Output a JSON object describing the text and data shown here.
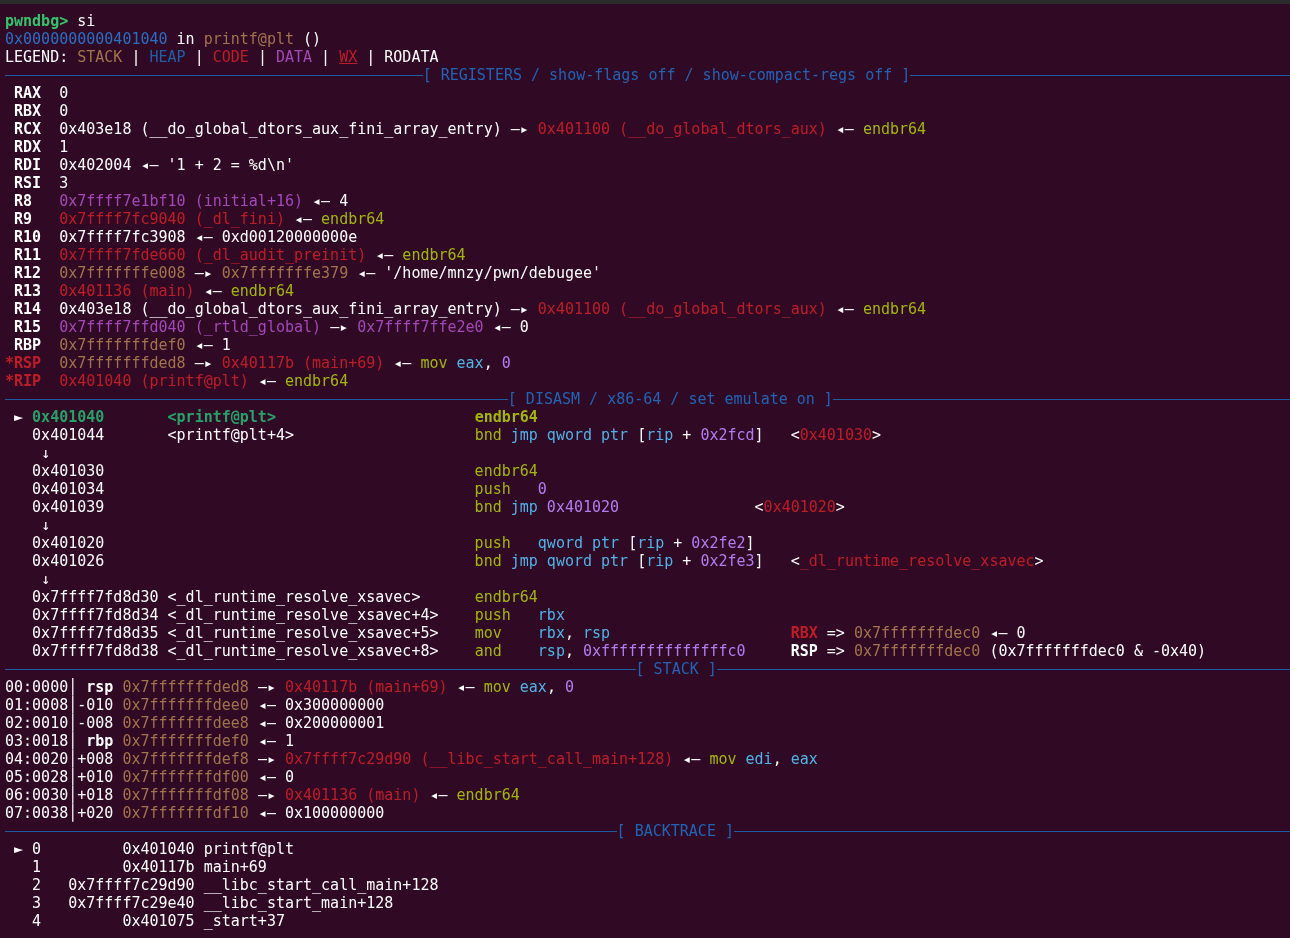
{
  "top_lines": [
    [
      {
        "text": "pwndbg>",
        "kind": "prompt"
      },
      {
        "text": " si",
        "kind": "plain"
      }
    ],
    [
      {
        "text": "0x0000000000401040",
        "kind": "addr"
      },
      {
        "text": " in",
        "kind": "plain"
      },
      {
        "text": " printf@plt",
        "kind": "stack"
      },
      {
        "text": " ()",
        "kind": "plain"
      }
    ],
    [
      {
        "text": "LEGEND:",
        "kind": "plain"
      },
      {
        "text": " STACK",
        "kind": "stack"
      },
      {
        "text": " |",
        "kind": "plain"
      },
      {
        "text": " HEAP",
        "kind": "heap"
      },
      {
        "text": " |",
        "kind": "plain"
      },
      {
        "text": " CODE",
        "kind": "code"
      },
      {
        "text": " |",
        "kind": "plain"
      },
      {
        "text": " DATA",
        "kind": "data"
      },
      {
        "text": " |",
        "kind": "plain"
      },
      {
        "text": " WX",
        "kind": "wx"
      },
      {
        "text": " |",
        "kind": "plain"
      },
      {
        "text": " RODATA",
        "kind": "plain"
      }
    ]
  ],
  "sections": [
    {
      "title": "[ REGISTERS / show-flags off / show-compact-regs off ]",
      "lines": [
        [
          {
            "text": " RAX",
            "kind": "bold"
          },
          {
            "text": "  0",
            "kind": "plain"
          }
        ],
        [
          {
            "text": " RBX",
            "kind": "bold"
          },
          {
            "text": "  0",
            "kind": "plain"
          }
        ],
        [
          {
            "text": " RCX",
            "kind": "bold"
          },
          {
            "text": "  0x403e18 (__do_global_dtors_aux_fini_array_entry)",
            "kind": "plain"
          },
          {
            "text": " —▸",
            "kind": "plain"
          },
          {
            "text": " 0x401100 (__do_global_dtors_aux)",
            "kind": "code"
          },
          {
            "text": " ◂—",
            "kind": "plain"
          },
          {
            "text": " endbr64",
            "kind": "insn"
          }
        ],
        [
          {
            "text": " RDX",
            "kind": "bold"
          },
          {
            "text": "  1",
            "kind": "plain"
          }
        ],
        [
          {
            "text": " RDI",
            "kind": "bold"
          },
          {
            "text": "  0x402004",
            "kind": "plain"
          },
          {
            "text": " ◂—",
            "kind": "plain"
          },
          {
            "text": " '1 + 2 = %d\\n'",
            "kind": "plain"
          }
        ],
        [
          {
            "text": " RSI",
            "kind": "bold"
          },
          {
            "text": "  3",
            "kind": "plain"
          }
        ],
        [
          {
            "text": " R8",
            "kind": "bold"
          },
          {
            "text": "   0x7ffff7e1bf10 (initial+16)",
            "kind": "data"
          },
          {
            "text": " ◂—",
            "kind": "plain"
          },
          {
            "text": " 4",
            "kind": "plain"
          }
        ],
        [
          {
            "text": " R9",
            "kind": "bold"
          },
          {
            "text": "   0x7ffff7fc9040 (_dl_fini)",
            "kind": "code"
          },
          {
            "text": " ◂—",
            "kind": "plain"
          },
          {
            "text": " endbr64",
            "kind": "insn"
          }
        ],
        [
          {
            "text": " R10",
            "kind": "bold"
          },
          {
            "text": "  0x7ffff7fc3908",
            "kind": "plain"
          },
          {
            "text": " ◂—",
            "kind": "plain"
          },
          {
            "text": " 0xd00120000000e",
            "kind": "plain"
          }
        ],
        [
          {
            "text": " R11",
            "kind": "bold"
          },
          {
            "text": "  0x7ffff7fde660 (_dl_audit_preinit)",
            "kind": "code"
          },
          {
            "text": " ◂—",
            "kind": "plain"
          },
          {
            "text": " endbr64",
            "kind": "insn"
          }
        ],
        [
          {
            "text": " R12",
            "kind": "bold"
          },
          {
            "text": "  0x7fffffffe008",
            "kind": "stack"
          },
          {
            "text": " —▸",
            "kind": "plain"
          },
          {
            "text": " 0x7fffffffe379",
            "kind": "stack"
          },
          {
            "text": " ◂—",
            "kind": "plain"
          },
          {
            "text": " '/home/mnzy/pwn/debugee'",
            "kind": "plain"
          }
        ],
        [
          {
            "text": " R13",
            "kind": "bold"
          },
          {
            "text": "  0x401136 (main)",
            "kind": "code"
          },
          {
            "text": " ◂—",
            "kind": "plain"
          },
          {
            "text": " endbr64",
            "kind": "insn"
          }
        ],
        [
          {
            "text": " R14",
            "kind": "bold"
          },
          {
            "text": "  0x403e18 (__do_global_dtors_aux_fini_array_entry)",
            "kind": "plain"
          },
          {
            "text": " —▸",
            "kind": "plain"
          },
          {
            "text": " 0x401100 (__do_global_dtors_aux)",
            "kind": "code"
          },
          {
            "text": " ◂—",
            "kind": "plain"
          },
          {
            "text": " endbr64",
            "kind": "insn"
          }
        ],
        [
          {
            "text": " R15",
            "kind": "bold"
          },
          {
            "text": "  0x7ffff7ffd040 (_rtld_global)",
            "kind": "data"
          },
          {
            "text": " —▸",
            "kind": "plain"
          },
          {
            "text": " 0x7ffff7ffe2e0",
            "kind": "data"
          },
          {
            "text": " ◂—",
            "kind": "plain"
          },
          {
            "text": " 0",
            "kind": "plain"
          }
        ],
        [
          {
            "text": " RBP",
            "kind": "bold"
          },
          {
            "text": "  0x7fffffffdef0",
            "kind": "stack"
          },
          {
            "text": " ◂—",
            "kind": "plain"
          },
          {
            "text": " 1",
            "kind": "plain"
          }
        ],
        [
          {
            "text": "*RSP",
            "kind": "boldred"
          },
          {
            "text": "  0x7fffffffded8",
            "kind": "stack"
          },
          {
            "text": " —▸",
            "kind": "plain"
          },
          {
            "text": " 0x40117b (main+69)",
            "kind": "code"
          },
          {
            "text": " ◂—",
            "kind": "plain"
          },
          {
            "text": " mov",
            "kind": "insn"
          },
          {
            "text": " eax",
            "kind": "reg"
          },
          {
            "text": ",",
            "kind": "plain"
          },
          {
            "text": " 0",
            "kind": "imm"
          }
        ],
        [
          {
            "text": "*RIP",
            "kind": "boldred"
          },
          {
            "text": "  0x401040 (printf@plt)",
            "kind": "code"
          },
          {
            "text": " ◂—",
            "kind": "plain"
          },
          {
            "text": " endbr64",
            "kind": "insn"
          }
        ]
      ]
    },
    {
      "title": "[ DISASM / x86-64 / set emulate on ]",
      "lines": [
        [
          {
            "text": " ►",
            "kind": "plain"
          },
          {
            "text": " 0x401040",
            "kind": "cur"
          },
          {
            "text": "       <printf@plt>",
            "kind": "cur"
          },
          {
            "text": "                      endbr64",
            "kind": "insnbold"
          }
        ],
        [
          {
            "text": "   0x401044",
            "kind": "plain"
          },
          {
            "text": "       <printf@plt+4>",
            "kind": "plain"
          },
          {
            "text": "                    bnd",
            "kind": "insn"
          },
          {
            "text": " jmp qword ptr",
            "kind": "reg"
          },
          {
            "text": " [",
            "kind": "plain"
          },
          {
            "text": "rip",
            "kind": "reg"
          },
          {
            "text": " +",
            "kind": "plain"
          },
          {
            "text": " 0x2fcd",
            "kind": "imm"
          },
          {
            "text": "]",
            "kind": "plain"
          },
          {
            "text": "   <",
            "kind": "plain"
          },
          {
            "text": "0x401030",
            "kind": "code"
          },
          {
            "text": ">",
            "kind": "plain"
          }
        ],
        [
          {
            "text": "    ↓",
            "kind": "plain"
          }
        ],
        [
          {
            "text": "   0x401030",
            "kind": "plain"
          },
          {
            "text": "                                         endbr64",
            "kind": "insn"
          }
        ],
        [
          {
            "text": "   0x401034",
            "kind": "plain"
          },
          {
            "text": "                                         push",
            "kind": "insn"
          },
          {
            "text": "   0",
            "kind": "imm"
          }
        ],
        [
          {
            "text": "   0x401039",
            "kind": "plain"
          },
          {
            "text": "                                         bnd",
            "kind": "insn"
          },
          {
            "text": " jmp",
            "kind": "reg"
          },
          {
            "text": " 0x401020",
            "kind": "imm"
          },
          {
            "text": "               <",
            "kind": "plain"
          },
          {
            "text": "0x401020",
            "kind": "code"
          },
          {
            "text": ">",
            "kind": "plain"
          }
        ],
        [
          {
            "text": "    ↓",
            "kind": "plain"
          }
        ],
        [
          {
            "text": "   0x401020",
            "kind": "plain"
          },
          {
            "text": "                                         push",
            "kind": "insn"
          },
          {
            "text": "   qword ptr",
            "kind": "reg"
          },
          {
            "text": " [",
            "kind": "plain"
          },
          {
            "text": "rip",
            "kind": "reg"
          },
          {
            "text": " +",
            "kind": "plain"
          },
          {
            "text": " 0x2fe2",
            "kind": "imm"
          },
          {
            "text": "]",
            "kind": "plain"
          }
        ],
        [
          {
            "text": "   0x401026",
            "kind": "plain"
          },
          {
            "text": "                                         bnd",
            "kind": "insn"
          },
          {
            "text": " jmp qword ptr",
            "kind": "reg"
          },
          {
            "text": " [",
            "kind": "plain"
          },
          {
            "text": "rip",
            "kind": "reg"
          },
          {
            "text": " +",
            "kind": "plain"
          },
          {
            "text": " 0x2fe3",
            "kind": "imm"
          },
          {
            "text": "]",
            "kind": "plain"
          },
          {
            "text": "   <",
            "kind": "plain"
          },
          {
            "text": "_dl_runtime_resolve_xsavec",
            "kind": "code"
          },
          {
            "text": ">",
            "kind": "plain"
          }
        ],
        [
          {
            "text": "    ↓",
            "kind": "plain"
          }
        ],
        [
          {
            "text": "   0x7ffff7fd8d30",
            "kind": "plain"
          },
          {
            "text": " <_dl_runtime_resolve_xsavec>",
            "kind": "plain"
          },
          {
            "text": "      endbr64",
            "kind": "insn"
          }
        ],
        [
          {
            "text": "   0x7ffff7fd8d34",
            "kind": "plain"
          },
          {
            "text": " <_dl_runtime_resolve_xsavec+4>",
            "kind": "plain"
          },
          {
            "text": "    push",
            "kind": "insn"
          },
          {
            "text": "   rbx",
            "kind": "reg"
          }
        ],
        [
          {
            "text": "   0x7ffff7fd8d35",
            "kind": "plain"
          },
          {
            "text": " <_dl_runtime_resolve_xsavec+5>",
            "kind": "plain"
          },
          {
            "text": "    mov",
            "kind": "insn"
          },
          {
            "text": "    rbx",
            "kind": "reg"
          },
          {
            "text": ",",
            "kind": "plain"
          },
          {
            "text": " rsp",
            "kind": "reg"
          },
          {
            "text": "                    RBX",
            "kind": "boldred"
          },
          {
            "text": " =>",
            "kind": "plain"
          },
          {
            "text": " 0x7fffffffdec0",
            "kind": "stack"
          },
          {
            "text": " ◂—",
            "kind": "plain"
          },
          {
            "text": " 0",
            "kind": "plain"
          }
        ],
        [
          {
            "text": "   0x7ffff7fd8d38",
            "kind": "plain"
          },
          {
            "text": " <_dl_runtime_resolve_xsavec+8>",
            "kind": "plain"
          },
          {
            "text": "    and",
            "kind": "insn"
          },
          {
            "text": "    rsp",
            "kind": "reg"
          },
          {
            "text": ",",
            "kind": "plain"
          },
          {
            "text": " 0xffffffffffffffc0",
            "kind": "imm"
          },
          {
            "text": "     RSP",
            "kind": "bold"
          },
          {
            "text": " =>",
            "kind": "plain"
          },
          {
            "text": " 0x7fffffffdec0",
            "kind": "stack"
          },
          {
            "text": " (0x7fffffffdec0 & -0x40)",
            "kind": "plain"
          }
        ]
      ]
    },
    {
      "title": "[ STACK ]",
      "lines": [
        [
          {
            "text": "00:0000",
            "kind": "plain"
          },
          {
            "text": "│",
            "kind": "plain"
          },
          {
            "text": " rsp",
            "kind": "bold"
          },
          {
            "text": " 0x7fffffffded8",
            "kind": "stack"
          },
          {
            "text": " —▸",
            "kind": "plain"
          },
          {
            "text": " 0x40117b (main+69)",
            "kind": "code"
          },
          {
            "text": " ◂—",
            "kind": "plain"
          },
          {
            "text": " mov",
            "kind": "insn"
          },
          {
            "text": " eax",
            "kind": "reg"
          },
          {
            "text": ",",
            "kind": "plain"
          },
          {
            "text": " 0",
            "kind": "imm"
          }
        ],
        [
          {
            "text": "01:0008",
            "kind": "plain"
          },
          {
            "text": "│",
            "kind": "plain"
          },
          {
            "text": "-010",
            "kind": "plain"
          },
          {
            "text": " 0x7fffffffdee0",
            "kind": "stack"
          },
          {
            "text": " ◂—",
            "kind": "plain"
          },
          {
            "text": " 0x300000000",
            "kind": "plain"
          }
        ],
        [
          {
            "text": "02:0010",
            "kind": "plain"
          },
          {
            "text": "│",
            "kind": "plain"
          },
          {
            "text": "-008",
            "kind": "plain"
          },
          {
            "text": " 0x7fffffffdee8",
            "kind": "stack"
          },
          {
            "text": " ◂—",
            "kind": "plain"
          },
          {
            "text": " 0x200000001",
            "kind": "plain"
          }
        ],
        [
          {
            "text": "03:0018",
            "kind": "plain"
          },
          {
            "text": "│",
            "kind": "plain"
          },
          {
            "text": " rbp",
            "kind": "bold"
          },
          {
            "text": " 0x7fffffffdef0",
            "kind": "stack"
          },
          {
            "text": " ◂—",
            "kind": "plain"
          },
          {
            "text": " 1",
            "kind": "plain"
          }
        ],
        [
          {
            "text": "04:0020",
            "kind": "plain"
          },
          {
            "text": "│",
            "kind": "plain"
          },
          {
            "text": "+008",
            "kind": "plain"
          },
          {
            "text": " 0x7fffffffdef8",
            "kind": "stack"
          },
          {
            "text": " —▸",
            "kind": "plain"
          },
          {
            "text": " 0x7ffff7c29d90 (__libc_start_call_main+128)",
            "kind": "code"
          },
          {
            "text": " ◂—",
            "kind": "plain"
          },
          {
            "text": " mov",
            "kind": "insn"
          },
          {
            "text": " edi",
            "kind": "reg"
          },
          {
            "text": ",",
            "kind": "plain"
          },
          {
            "text": " eax",
            "kind": "reg"
          }
        ],
        [
          {
            "text": "05:0028",
            "kind": "plain"
          },
          {
            "text": "│",
            "kind": "plain"
          },
          {
            "text": "+010",
            "kind": "plain"
          },
          {
            "text": " 0x7fffffffdf00",
            "kind": "stack"
          },
          {
            "text": " ◂—",
            "kind": "plain"
          },
          {
            "text": " 0",
            "kind": "plain"
          }
        ],
        [
          {
            "text": "06:0030",
            "kind": "plain"
          },
          {
            "text": "│",
            "kind": "plain"
          },
          {
            "text": "+018",
            "kind": "plain"
          },
          {
            "text": " 0x7fffffffdf08",
            "kind": "stack"
          },
          {
            "text": " —▸",
            "kind": "plain"
          },
          {
            "text": " 0x401136 (main)",
            "kind": "code"
          },
          {
            "text": " ◂—",
            "kind": "plain"
          },
          {
            "text": " endbr64",
            "kind": "insn"
          }
        ],
        [
          {
            "text": "07:0038",
            "kind": "plain"
          },
          {
            "text": "│",
            "kind": "plain"
          },
          {
            "text": "+020",
            "kind": "plain"
          },
          {
            "text": " 0x7fffffffdf10",
            "kind": "stack"
          },
          {
            "text": " ◂—",
            "kind": "plain"
          },
          {
            "text": " 0x100000000",
            "kind": "plain"
          }
        ]
      ]
    },
    {
      "title": "[ BACKTRACE ]",
      "lines": [
        [
          {
            "text": " ►",
            "kind": "plain"
          },
          {
            "text": " 0",
            "kind": "plain"
          },
          {
            "text": "         0x401040",
            "kind": "plain"
          },
          {
            "text": " printf@plt",
            "kind": "plain"
          }
        ],
        [
          {
            "text": "   1",
            "kind": "plain"
          },
          {
            "text": "         0x40117b",
            "kind": "plain"
          },
          {
            "text": " main+69",
            "kind": "plain"
          }
        ],
        [
          {
            "text": "   2",
            "kind": "plain"
          },
          {
            "text": "   0x7ffff7c29d90",
            "kind": "plain"
          },
          {
            "text": " __libc_start_call_main+128",
            "kind": "plain"
          }
        ],
        [
          {
            "text": "   3",
            "kind": "plain"
          },
          {
            "text": "   0x7ffff7c29e40",
            "kind": "plain"
          },
          {
            "text": " __libc_start_main+128",
            "kind": "plain"
          }
        ],
        [
          {
            "text": "   4",
            "kind": "plain"
          },
          {
            "text": "         0x401075",
            "kind": "plain"
          },
          {
            "text": " _start+37",
            "kind": "plain"
          }
        ]
      ]
    }
  ]
}
